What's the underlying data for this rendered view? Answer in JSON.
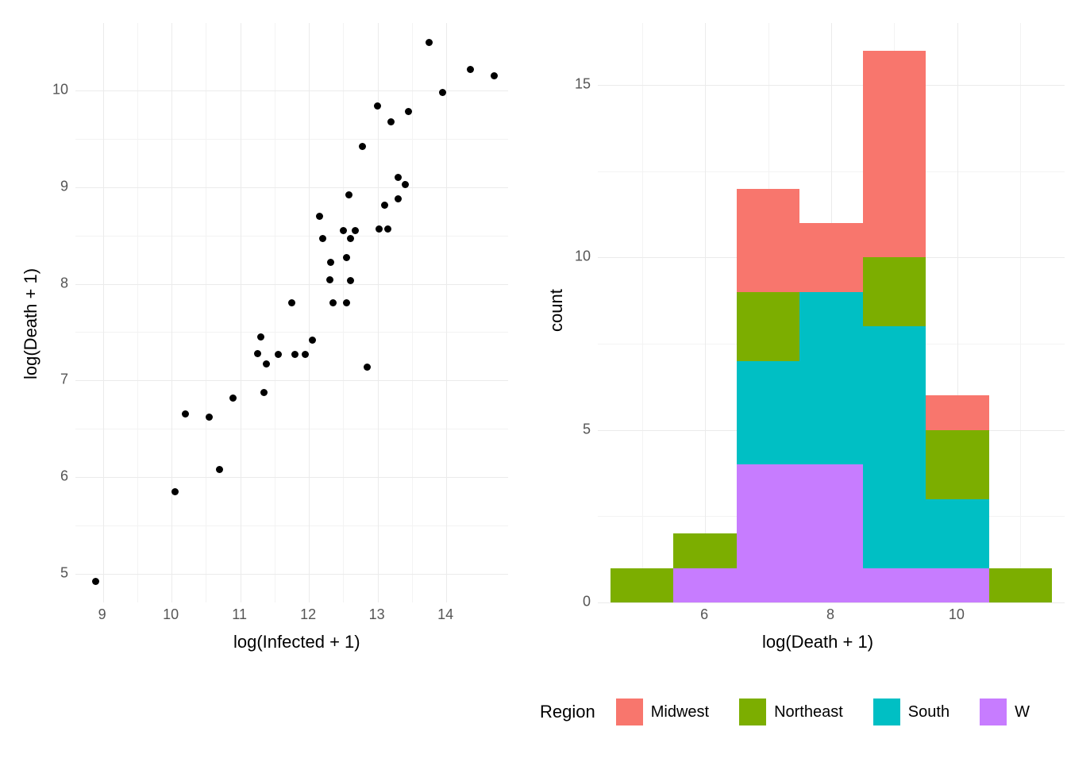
{
  "chart_data": [
    {
      "type": "scatter",
      "xlabel": "log(Infected + 1)",
      "ylabel": "log(Death + 1)",
      "xlim": [
        8.6,
        14.9
      ],
      "ylim": [
        4.7,
        10.7
      ],
      "x_ticks": [
        9,
        10,
        11,
        12,
        13,
        14
      ],
      "y_ticks": [
        5,
        6,
        7,
        8,
        9,
        10
      ],
      "points": [
        {
          "x": 8.9,
          "y": 4.92
        },
        {
          "x": 10.05,
          "y": 5.85
        },
        {
          "x": 10.2,
          "y": 6.65
        },
        {
          "x": 10.55,
          "y": 6.62
        },
        {
          "x": 10.7,
          "y": 6.08
        },
        {
          "x": 10.9,
          "y": 6.82
        },
        {
          "x": 11.25,
          "y": 7.28
        },
        {
          "x": 11.3,
          "y": 7.45
        },
        {
          "x": 11.35,
          "y": 6.87
        },
        {
          "x": 11.38,
          "y": 7.17
        },
        {
          "x": 11.55,
          "y": 7.27
        },
        {
          "x": 11.75,
          "y": 7.8
        },
        {
          "x": 11.8,
          "y": 7.27
        },
        {
          "x": 11.95,
          "y": 7.27
        },
        {
          "x": 12.05,
          "y": 7.42
        },
        {
          "x": 12.15,
          "y": 8.7
        },
        {
          "x": 12.2,
          "y": 8.47
        },
        {
          "x": 12.3,
          "y": 8.04
        },
        {
          "x": 12.32,
          "y": 8.22
        },
        {
          "x": 12.35,
          "y": 7.8
        },
        {
          "x": 12.5,
          "y": 8.55
        },
        {
          "x": 12.55,
          "y": 7.8
        },
        {
          "x": 12.55,
          "y": 8.27
        },
        {
          "x": 12.58,
          "y": 8.92
        },
        {
          "x": 12.6,
          "y": 8.47
        },
        {
          "x": 12.6,
          "y": 8.03
        },
        {
          "x": 12.68,
          "y": 8.55
        },
        {
          "x": 12.78,
          "y": 9.42
        },
        {
          "x": 12.85,
          "y": 7.14
        },
        {
          "x": 13.0,
          "y": 9.84
        },
        {
          "x": 13.02,
          "y": 8.57
        },
        {
          "x": 13.1,
          "y": 8.81
        },
        {
          "x": 13.15,
          "y": 8.57
        },
        {
          "x": 13.2,
          "y": 9.68
        },
        {
          "x": 13.3,
          "y": 8.88
        },
        {
          "x": 13.3,
          "y": 9.1
        },
        {
          "x": 13.4,
          "y": 9.03
        },
        {
          "x": 13.45,
          "y": 9.78
        },
        {
          "x": 13.75,
          "y": 10.5
        },
        {
          "x": 13.95,
          "y": 9.98
        },
        {
          "x": 14.35,
          "y": 10.22
        },
        {
          "x": 14.7,
          "y": 10.15
        }
      ]
    },
    {
      "type": "bar",
      "stacked": true,
      "xlabel": "log(Death + 1)",
      "ylabel": "count",
      "xlim": [
        4.3,
        11.7
      ],
      "ylim": [
        0,
        16.8
      ],
      "x_ticks": [
        6,
        8,
        10
      ],
      "y_ticks": [
        0,
        5,
        10,
        15
      ],
      "bin_edges": [
        4.5,
        5.5,
        6.5,
        7.5,
        8.5,
        9.5,
        10.5,
        11.5
      ],
      "series_order_bottom_to_top": [
        "West",
        "South",
        "Northeast",
        "Midwest"
      ],
      "colors": {
        "Midwest": "#F8766D",
        "Northeast": "#7CAE00",
        "South": "#00BFC4",
        "West": "#C77CFF"
      },
      "bins": [
        {
          "mid": 5.0,
          "stacks": {
            "West": 0,
            "South": 0,
            "Northeast": 1,
            "Midwest": 0
          }
        },
        {
          "mid": 6.0,
          "stacks": {
            "West": 1,
            "South": 0,
            "Northeast": 1,
            "Midwest": 0
          }
        },
        {
          "mid": 7.0,
          "stacks": {
            "West": 4,
            "South": 3,
            "Northeast": 2,
            "Midwest": 3
          }
        },
        {
          "mid": 8.0,
          "stacks": {
            "West": 4,
            "South": 5,
            "Northeast": 0,
            "Midwest": 2
          }
        },
        {
          "mid": 9.0,
          "stacks": {
            "West": 1,
            "South": 7,
            "Northeast": 2,
            "Midwest": 6
          }
        },
        {
          "mid": 10.0,
          "stacks": {
            "West": 1,
            "South": 2,
            "Northeast": 2,
            "Midwest": 1
          }
        },
        {
          "mid": 11.0,
          "stacks": {
            "West": 0,
            "South": 0,
            "Northeast": 1,
            "Midwest": 0
          }
        }
      ]
    }
  ],
  "legend": {
    "title": "Region",
    "items": [
      "Midwest",
      "Northeast",
      "South",
      "W"
    ]
  }
}
